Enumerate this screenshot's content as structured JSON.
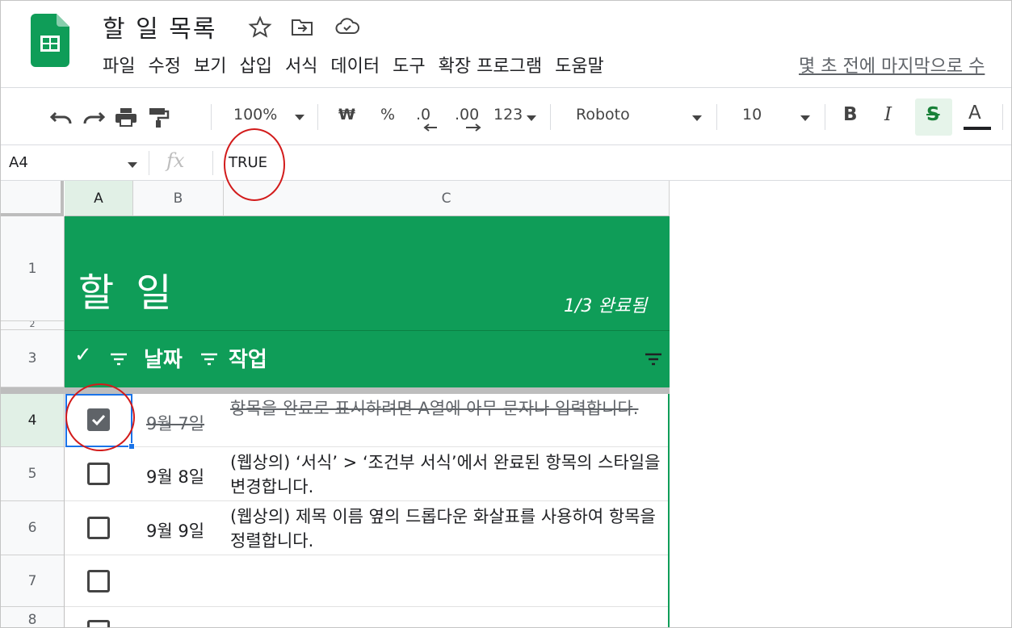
{
  "app": {
    "doc_title": "할 일 목록",
    "icons": [
      "star-icon",
      "move-to-folder-icon",
      "cloud-saved-icon"
    ],
    "menu": [
      "파일",
      "수정",
      "보기",
      "삽입",
      "서식",
      "데이터",
      "도구",
      "확장 프로그램",
      "도움말"
    ],
    "last_edit": "몇 초 전에 마지막으로 수"
  },
  "toolbar": {
    "zoom": "100%",
    "currency": "₩",
    "percent": "%",
    "decimal_decrease": ".0",
    "decimal_increase": ".00",
    "number_format": "123",
    "font": "Roboto",
    "font_size": "10",
    "bold": "B",
    "italic": "I",
    "strikethrough": "S",
    "text_color": "A"
  },
  "formula_bar": {
    "name_box": "A4",
    "fx_label": "fx",
    "value": "TRUE"
  },
  "columns": [
    "A",
    "B",
    "C"
  ],
  "row_numbers": [
    "1",
    "2",
    "3",
    "4",
    "5",
    "6",
    "7",
    "8"
  ],
  "todo": {
    "title": "할 일",
    "progress": "1/3 완료됨",
    "header_check": "✓",
    "header_date": "날짜",
    "header_task": "작업",
    "items": [
      {
        "date": "9월 7일",
        "task": "항목을 완료로 표시하려면 A열에 아무 문자나 입력합니다.",
        "checked": true
      },
      {
        "date": "9월 8일",
        "task": "(웹상의) ‘서식’ > ‘조건부 서식’에서 완료된 항목의 스타일을 변경합니다.",
        "checked": false
      },
      {
        "date": "9월 9일",
        "task": "(웹상의) 제목 이름 옆의 드롭다운 화살표를 사용하여 항목을 정렬합니다.",
        "checked": false
      }
    ]
  },
  "colors": {
    "sheets_green": "#0f9d58",
    "selection_blue": "#1a73e8",
    "annotation_red": "#d21b1b"
  }
}
